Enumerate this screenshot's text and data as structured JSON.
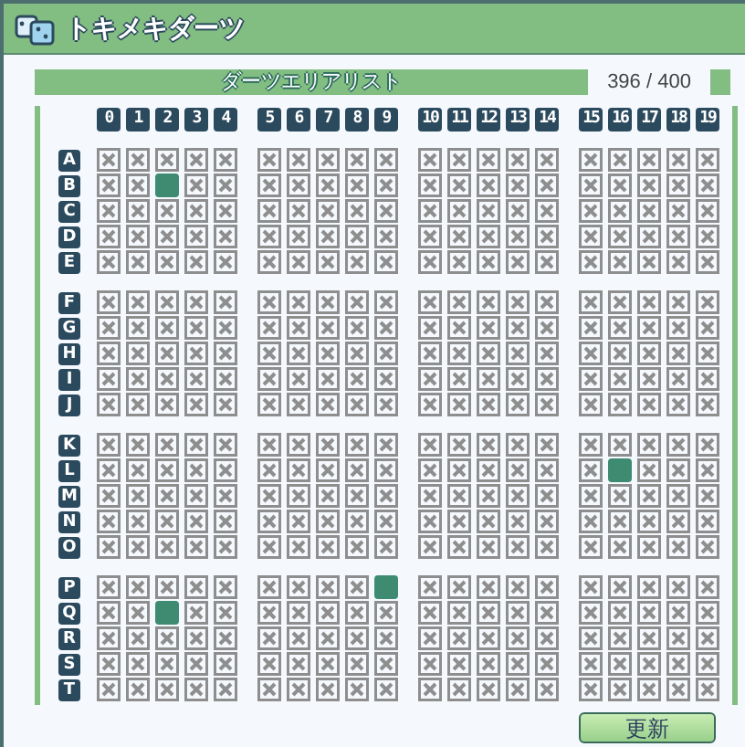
{
  "window": {
    "title": "トキメキダーツ"
  },
  "header": {
    "title": "ダーツエリアリスト",
    "count": "396 / 400"
  },
  "columns": [
    "0",
    "1",
    "2",
    "3",
    "4",
    "5",
    "6",
    "7",
    "8",
    "9",
    "10",
    "11",
    "12",
    "13",
    "14",
    "15",
    "16",
    "17",
    "18",
    "19"
  ],
  "rows": [
    {
      "label": "A",
      "available": [
        false,
        false,
        false,
        false,
        false,
        false,
        false,
        false,
        false,
        false,
        false,
        false,
        false,
        false,
        false,
        false,
        false,
        false,
        false,
        false
      ]
    },
    {
      "label": "B",
      "available": [
        false,
        false,
        true,
        false,
        false,
        false,
        false,
        false,
        false,
        false,
        false,
        false,
        false,
        false,
        false,
        false,
        false,
        false,
        false,
        false
      ]
    },
    {
      "label": "C",
      "available": [
        false,
        false,
        false,
        false,
        false,
        false,
        false,
        false,
        false,
        false,
        false,
        false,
        false,
        false,
        false,
        false,
        false,
        false,
        false,
        false
      ]
    },
    {
      "label": "D",
      "available": [
        false,
        false,
        false,
        false,
        false,
        false,
        false,
        false,
        false,
        false,
        false,
        false,
        false,
        false,
        false,
        false,
        false,
        false,
        false,
        false
      ]
    },
    {
      "label": "E",
      "available": [
        false,
        false,
        false,
        false,
        false,
        false,
        false,
        false,
        false,
        false,
        false,
        false,
        false,
        false,
        false,
        false,
        false,
        false,
        false,
        false
      ]
    },
    {
      "label": "F",
      "available": [
        false,
        false,
        false,
        false,
        false,
        false,
        false,
        false,
        false,
        false,
        false,
        false,
        false,
        false,
        false,
        false,
        false,
        false,
        false,
        false
      ]
    },
    {
      "label": "G",
      "available": [
        false,
        false,
        false,
        false,
        false,
        false,
        false,
        false,
        false,
        false,
        false,
        false,
        false,
        false,
        false,
        false,
        false,
        false,
        false,
        false
      ]
    },
    {
      "label": "H",
      "available": [
        false,
        false,
        false,
        false,
        false,
        false,
        false,
        false,
        false,
        false,
        false,
        false,
        false,
        false,
        false,
        false,
        false,
        false,
        false,
        false
      ]
    },
    {
      "label": "I",
      "available": [
        false,
        false,
        false,
        false,
        false,
        false,
        false,
        false,
        false,
        false,
        false,
        false,
        false,
        false,
        false,
        false,
        false,
        false,
        false,
        false
      ]
    },
    {
      "label": "J",
      "available": [
        false,
        false,
        false,
        false,
        false,
        false,
        false,
        false,
        false,
        false,
        false,
        false,
        false,
        false,
        false,
        false,
        false,
        false,
        false,
        false
      ]
    },
    {
      "label": "K",
      "available": [
        false,
        false,
        false,
        false,
        false,
        false,
        false,
        false,
        false,
        false,
        false,
        false,
        false,
        false,
        false,
        false,
        false,
        false,
        false,
        false
      ]
    },
    {
      "label": "L",
      "available": [
        false,
        false,
        false,
        false,
        false,
        false,
        false,
        false,
        false,
        false,
        false,
        false,
        false,
        false,
        false,
        false,
        true,
        false,
        false,
        false
      ]
    },
    {
      "label": "M",
      "available": [
        false,
        false,
        false,
        false,
        false,
        false,
        false,
        false,
        false,
        false,
        false,
        false,
        false,
        false,
        false,
        false,
        false,
        false,
        false,
        false
      ]
    },
    {
      "label": "N",
      "available": [
        false,
        false,
        false,
        false,
        false,
        false,
        false,
        false,
        false,
        false,
        false,
        false,
        false,
        false,
        false,
        false,
        false,
        false,
        false,
        false
      ]
    },
    {
      "label": "O",
      "available": [
        false,
        false,
        false,
        false,
        false,
        false,
        false,
        false,
        false,
        false,
        false,
        false,
        false,
        false,
        false,
        false,
        false,
        false,
        false,
        false
      ]
    },
    {
      "label": "P",
      "available": [
        false,
        false,
        false,
        false,
        false,
        false,
        false,
        false,
        false,
        true,
        false,
        false,
        false,
        false,
        false,
        false,
        false,
        false,
        false,
        false
      ]
    },
    {
      "label": "Q",
      "available": [
        false,
        false,
        true,
        false,
        false,
        false,
        false,
        false,
        false,
        false,
        false,
        false,
        false,
        false,
        false,
        false,
        false,
        false,
        false,
        false
      ]
    },
    {
      "label": "R",
      "available": [
        false,
        false,
        false,
        false,
        false,
        false,
        false,
        false,
        false,
        false,
        false,
        false,
        false,
        false,
        false,
        false,
        false,
        false,
        false,
        false
      ]
    },
    {
      "label": "S",
      "available": [
        false,
        false,
        false,
        false,
        false,
        false,
        false,
        false,
        false,
        false,
        false,
        false,
        false,
        false,
        false,
        false,
        false,
        false,
        false,
        false
      ]
    },
    {
      "label": "T",
      "available": [
        false,
        false,
        false,
        false,
        false,
        false,
        false,
        false,
        false,
        false,
        false,
        false,
        false,
        false,
        false,
        false,
        false,
        false,
        false,
        false
      ]
    }
  ],
  "buttons": [
    "更新"
  ]
}
